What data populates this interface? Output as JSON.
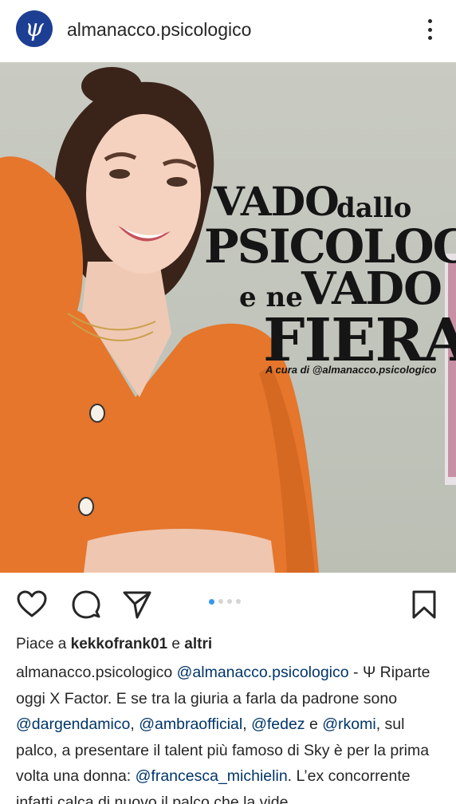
{
  "header": {
    "avatar_glyph": "ψ",
    "username": "almanacco.psicologico",
    "more_icon": "more-vertical-icon"
  },
  "post": {
    "headline": {
      "vado1": "VADO",
      "dallo": "dallo",
      "psicologo": "PSICOLOGO",
      "e_ne": "e ne",
      "vado2": "VADO",
      "fiera": "FIERA"
    },
    "credit": "A cura di @almanacco.psicologico",
    "colors": {
      "background": "#c6c9c0",
      "sweater": "#e5762c",
      "avatar": "#1c3f94",
      "mention": "#003569",
      "carousel_active": "#3897f0"
    }
  },
  "actions": {
    "icons": [
      "heart-icon",
      "comment-icon",
      "share-icon",
      "bookmark-icon"
    ],
    "carousel_total": 4,
    "carousel_current": 1
  },
  "likes": {
    "prefix": "Piace a",
    "user": "kekkofrank01",
    "connector": "e",
    "others": "altri"
  },
  "caption": {
    "author": "almanacco.psicologico",
    "p1": " ",
    "m1": "@almanacco.psicologico",
    "p2": " - Ψ Riparte oggi X Factor. E se tra la giuria a farla da padrone sono ",
    "m2": "@dargendamico",
    "p3": ", ",
    "m3": "@ambraofficial",
    "p4": ", ",
    "m4": "@fedez",
    "p5": " e ",
    "m5": "@rkomi",
    "p6": ", sul palco, a presentare il talent più famoso di Sky è per la prima volta una donna: ",
    "m6": "@francesca_michielin",
    "p7": ". L’ex concorrente infatti calca di nuovo il palco che la vide"
  }
}
